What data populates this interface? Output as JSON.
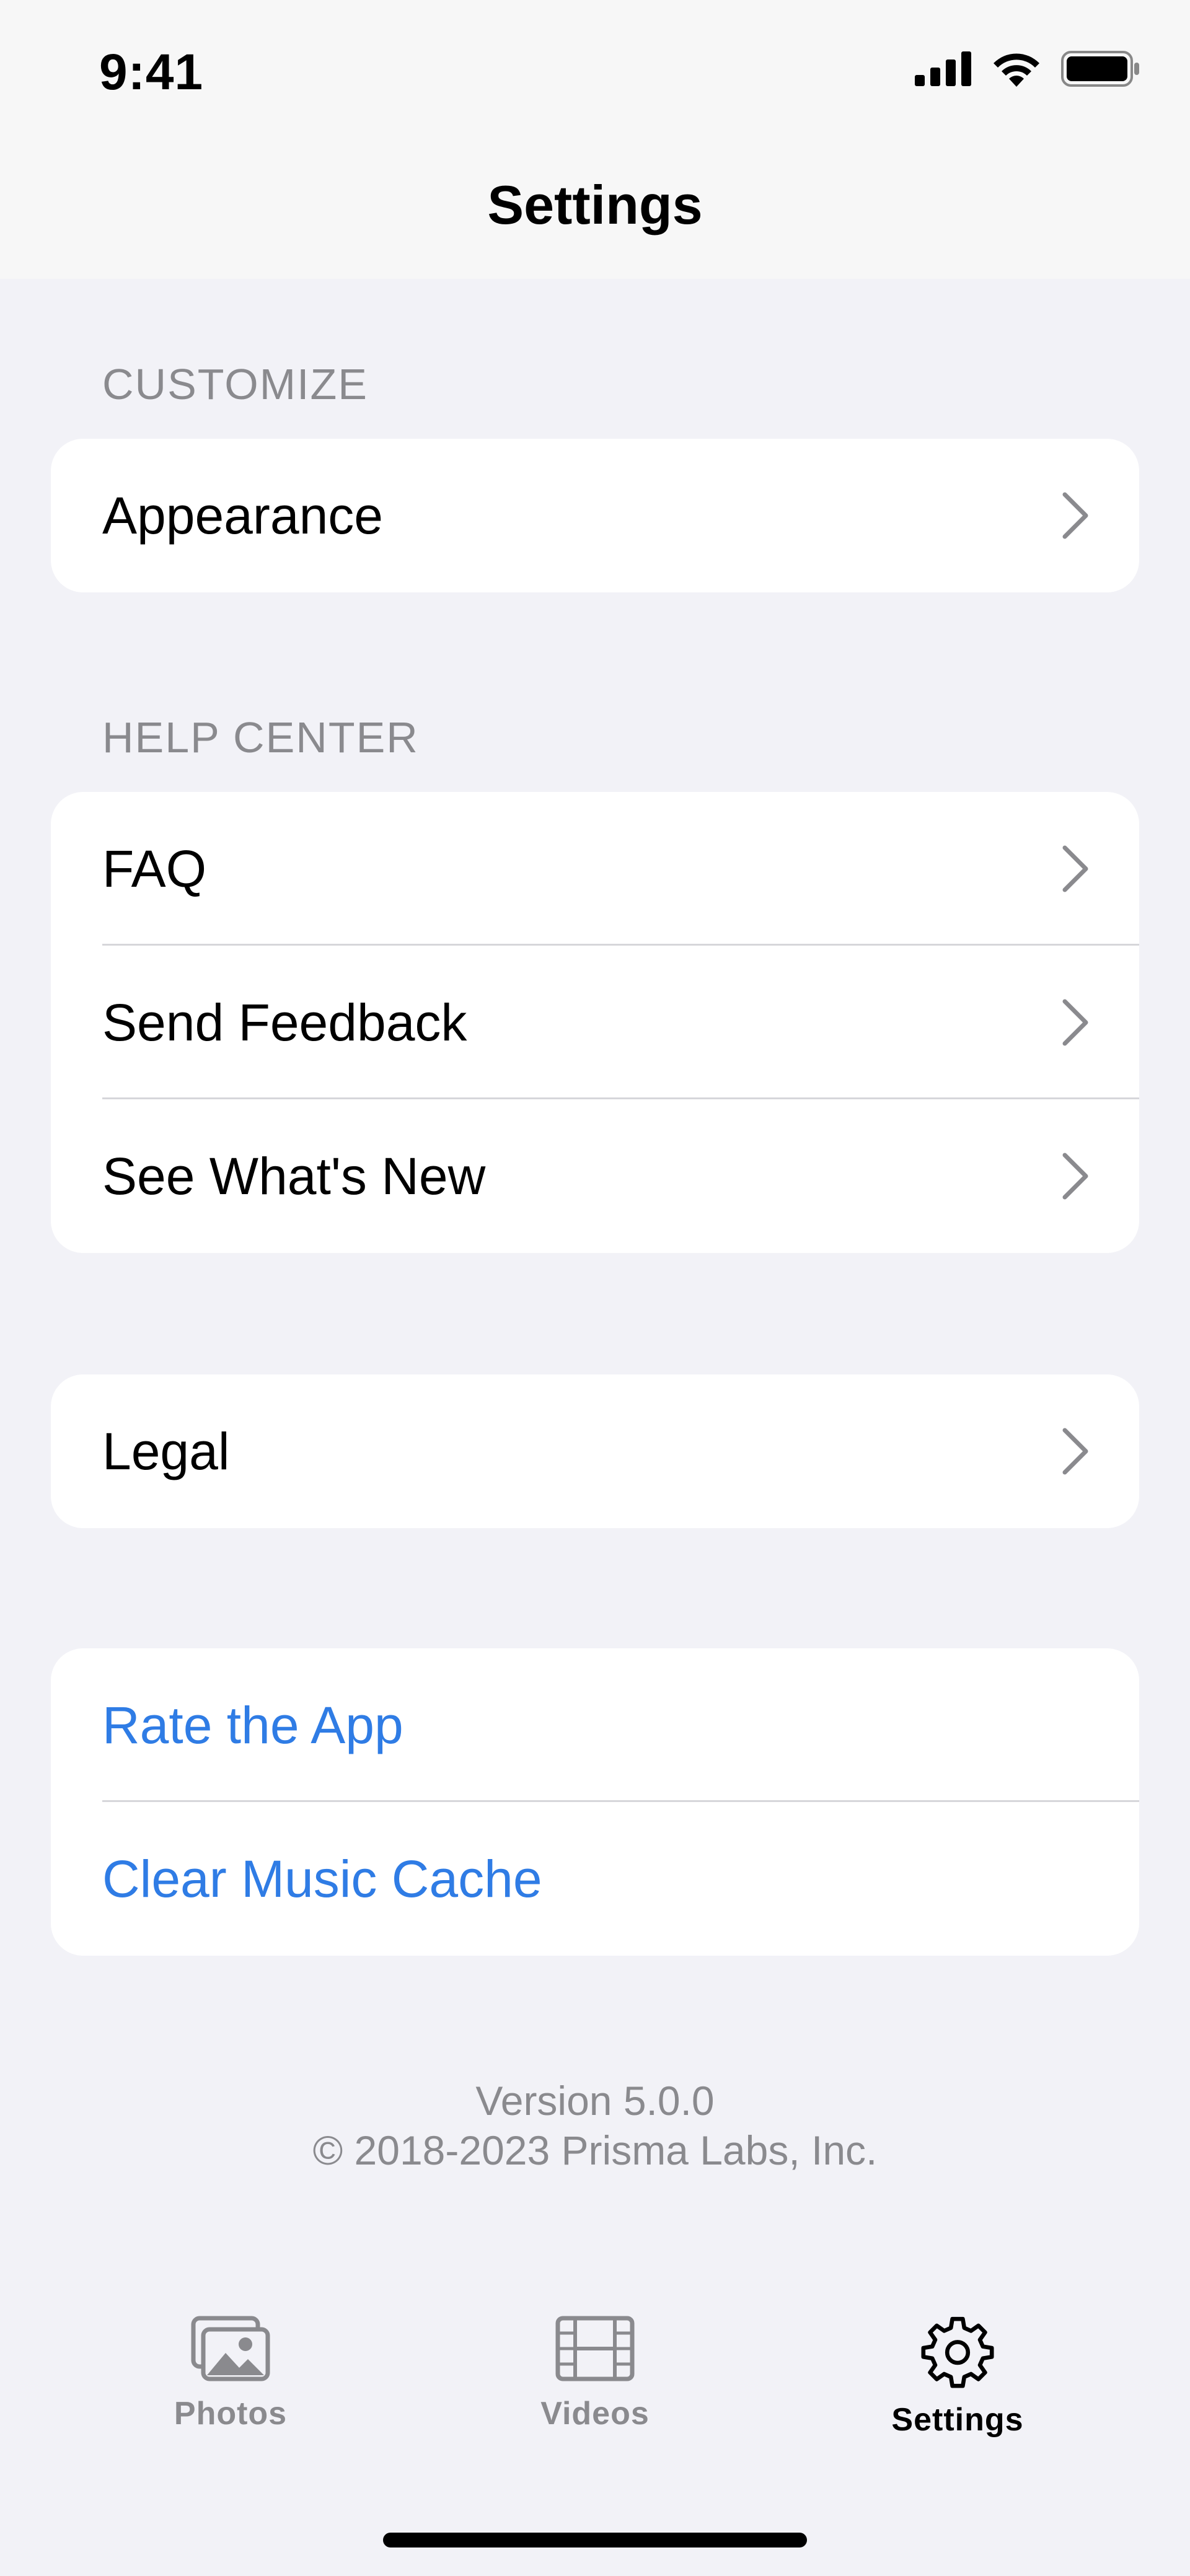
{
  "status_bar": {
    "time": "9:41",
    "icons": [
      "cellular-signal-icon",
      "wifi-icon",
      "battery-icon"
    ]
  },
  "nav": {
    "title": "Settings"
  },
  "sections": {
    "customize": {
      "header": "CUSTOMIZE",
      "items": [
        {
          "label": "Appearance"
        }
      ]
    },
    "help_center": {
      "header": "HELP CENTER",
      "items": [
        {
          "label": "FAQ"
        },
        {
          "label": "Send Feedback"
        },
        {
          "label": "See What's New"
        }
      ]
    },
    "legal": {
      "items": [
        {
          "label": "Legal"
        }
      ]
    },
    "actions": {
      "items": [
        {
          "label": "Rate the App"
        },
        {
          "label": "Clear Music Cache"
        }
      ]
    }
  },
  "footer": {
    "version": "Version 5.0.0",
    "copyright": "© 2018-2023 Prisma Labs, Inc."
  },
  "tab_bar": {
    "tabs": [
      {
        "label": "Photos",
        "icon": "photos-icon",
        "active": false
      },
      {
        "label": "Videos",
        "icon": "film-icon",
        "active": false
      },
      {
        "label": "Settings",
        "icon": "gear-icon",
        "active": true
      }
    ]
  },
  "colors": {
    "background": "#F2F2F7",
    "card": "#FFFFFF",
    "accent_blue": "#2F7CE5",
    "secondary_text": "#8A8A8E",
    "separator": "#D6D6DA"
  }
}
